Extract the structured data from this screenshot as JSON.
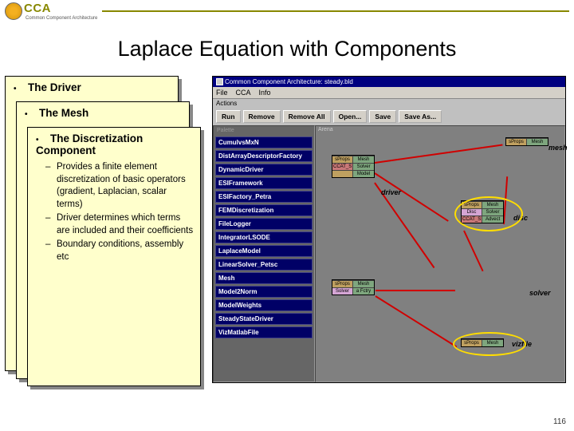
{
  "header": {
    "logo": "CCA",
    "sub": "Common Component Architecture"
  },
  "title": "Laplace Equation with Components",
  "cards": {
    "c1": "The Driver",
    "c2": "The Mesh",
    "c3": "The Discretization Component",
    "c3_items": [
      "Provides a finite element discretization of basic operators (gradient, Laplacian, scalar terms)",
      "Driver determines which terms are included and their coefficients",
      "Boundary conditions, assembly etc"
    ]
  },
  "app": {
    "title": "Common Component Architecture: steady.bld",
    "menu": [
      "File",
      "CCA",
      "Info"
    ],
    "actions_label": "Actions",
    "toolbar": [
      "Run",
      "Remove",
      "Remove All",
      "Open...",
      "Save",
      "Save As..."
    ],
    "palette_label": "Palette",
    "arena_label": "Arena",
    "palette": [
      "CumulvsMxN",
      "DistArrayDescriptorFactory",
      "DynamicDriver",
      "ESIFramework",
      "ESIFactory_Petra",
      "FEMDiscretization",
      "FileLogger",
      "IntegratorLSODE",
      "LaplaceModel",
      "LinearSolver_Petsc",
      "Mesh",
      "Model2Norm",
      "ModelWeights",
      "SteadyStateDriver",
      "VizMatlabFile"
    ],
    "components": {
      "mesh": {
        "label": "mesh",
        "rows": [
          [
            "sProps",
            "Mesh"
          ]
        ]
      },
      "driver": {
        "label": "driver",
        "rows": [
          [
            "sProps",
            "Mesh"
          ],
          [
            "CCAT_S",
            "Solver"
          ],
          [
            "",
            "Model"
          ]
        ]
      },
      "disc": {
        "label": "disc",
        "rows": [
          [
            "sProps",
            "Mesh"
          ],
          [
            "Disc",
            "Solver"
          ],
          [
            "CCAT_S",
            "Advect"
          ]
        ]
      },
      "solver": {
        "label": "solver",
        "rows": [
          [
            "sProps",
            "Mesh"
          ],
          [
            "Solver",
            "a Fctry"
          ]
        ]
      },
      "vizfile": {
        "label": "vizfile",
        "rows": [
          [
            "sProps",
            "Mesh"
          ]
        ]
      }
    }
  },
  "pagenum": "116"
}
